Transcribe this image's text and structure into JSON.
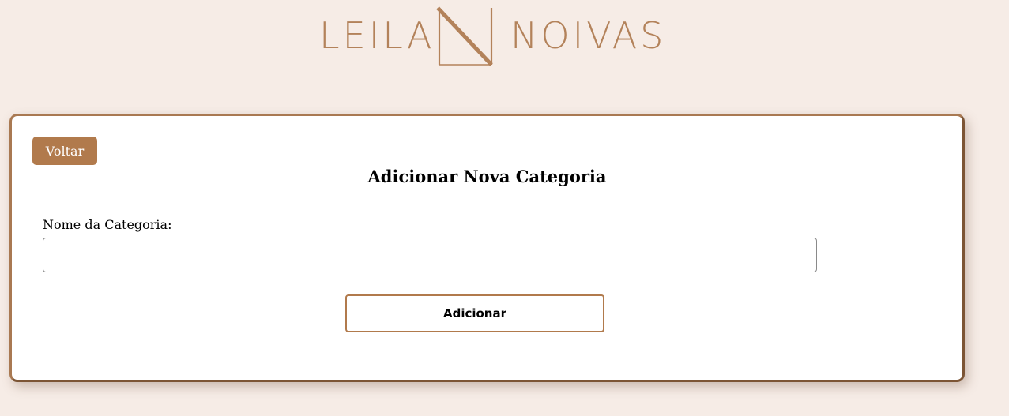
{
  "brand": {
    "name_left": "LEILA",
    "name_right": "NOIVAS",
    "monogram": "LN",
    "color": "#b3825a"
  },
  "form": {
    "back_label": "Voltar",
    "title": "Adicionar Nova Categoria",
    "field_label": "Nome da Categoria:",
    "field_value": "",
    "submit_label": "Adicionar"
  },
  "colors": {
    "background": "#f6ece6",
    "accent": "#b17a4c",
    "card": "#ffffff"
  }
}
